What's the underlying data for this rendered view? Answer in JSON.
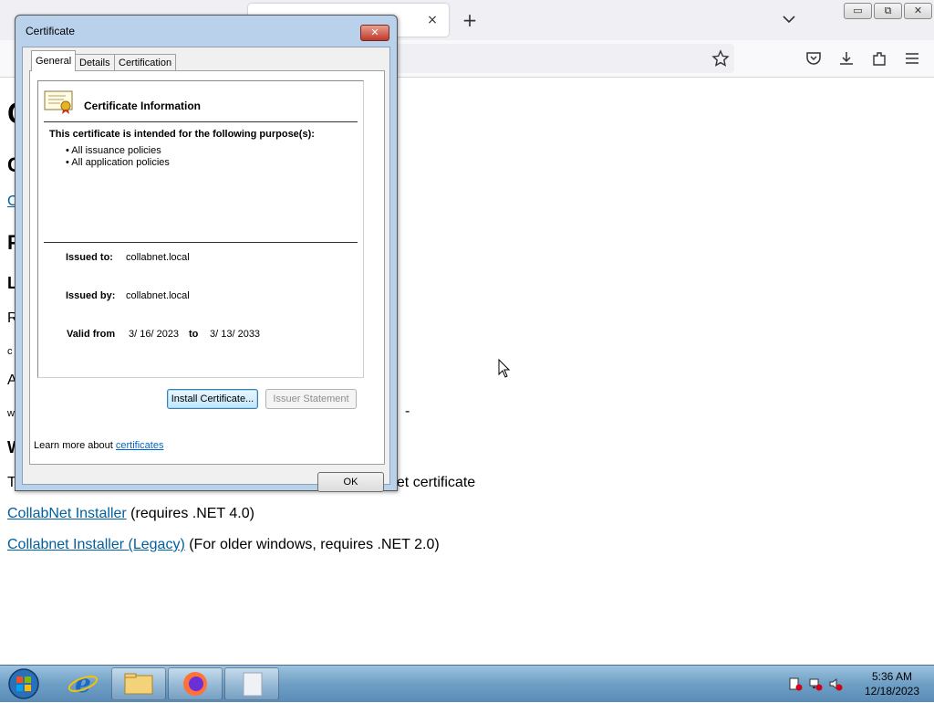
{
  "browser": {
    "tab_close": "×",
    "new_tab": "+",
    "window_buttons": {
      "minimize": "▭",
      "restore": "⧉",
      "close": "✕"
    }
  },
  "page": {
    "partial_letters": [
      "C",
      "C",
      "C",
      "P",
      "L",
      "R",
      "c",
      "A",
      "w",
      "W",
      "T"
    ],
    "cert_line_tail": "net certificate",
    "trailing_dash": "-",
    "installer_link": "CollabNet Installer",
    "installer_note": " (requires .NET 4.0)",
    "legacy_link": "Collabnet Installer (Legacy)",
    "legacy_note": " (For older windows, requires .NET 2.0)"
  },
  "dialog": {
    "title": "Certificate",
    "close": "✕",
    "tabs": [
      "General",
      "Details",
      "Certification Path"
    ],
    "info_title": "Certificate Information",
    "purpose_heading": "This certificate is intended for the following purpose(s):",
    "purposes": [
      "• All issuance policies",
      "• All application policies"
    ],
    "issued_to_label": "Issued to:",
    "issued_to_value": "collabnet.local",
    "issued_by_label": "Issued by:",
    "issued_by_value": "collabnet.local",
    "valid_from_label": "Valid from",
    "valid_from_value": "3/ 16/ 2023",
    "valid_to_label": "to",
    "valid_to_value": "3/ 13/ 2033",
    "install_button": "Install Certificate...",
    "issuer_statement_button": "Issuer Statement",
    "learn_more_prefix": "Learn more about ",
    "learn_more_link": "certificates",
    "ok_button": "OK"
  },
  "taskbar": {
    "time": "5:36 AM",
    "date": "12/18/2023"
  }
}
